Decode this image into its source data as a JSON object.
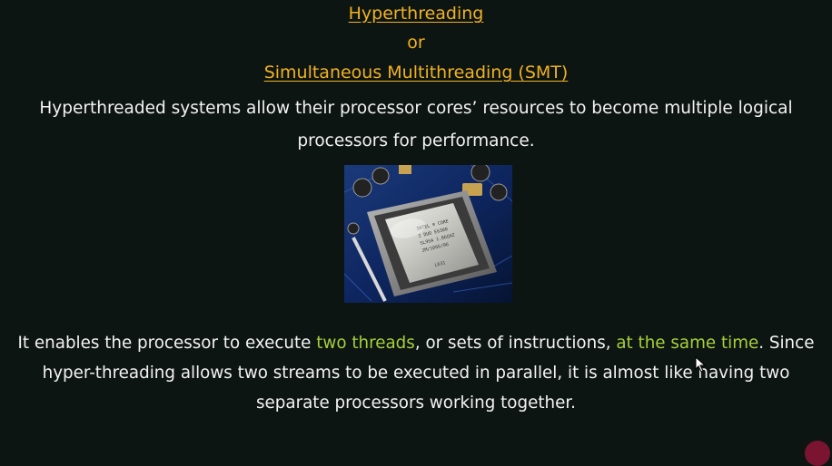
{
  "heading": {
    "line1": "Hyperthreading",
    "line2": "or",
    "line3": "Simultaneous Multithreading (SMT)"
  },
  "intro": "Hyperthreaded systems allow their processor cores’ resources to become multiple logical processors for performance.",
  "image": {
    "icon": "cpu-motherboard-photo"
  },
  "description": {
    "part1": "It enables the processor to execute ",
    "highlight1": "two threads",
    "part2": ", or sets of instructions, ",
    "highlight2": "at the same time",
    "part3": ". Since hyper-threading allows two streams to be executed in parallel, it is almost like having two separate processors working together."
  },
  "colors": {
    "background": "#0d1512",
    "heading": "#f2b21f",
    "body_text": "#f3f3f3",
    "highlight": "#a5cf3a"
  }
}
